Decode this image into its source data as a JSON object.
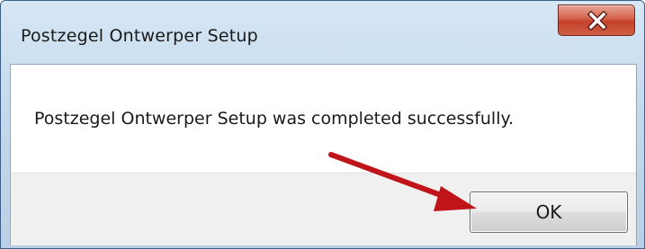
{
  "window": {
    "title": "Postzegel Ontwerper Setup"
  },
  "dialog": {
    "message": "Postzegel Ontwerper Setup was completed successfully.",
    "ok_label": "OK"
  },
  "icons": {
    "close": "close-icon",
    "annotation": "red-arrow-icon"
  },
  "colors": {
    "close_button": "#c94a33",
    "arrow": "#c0141b",
    "frame": "#c4d9ec"
  }
}
